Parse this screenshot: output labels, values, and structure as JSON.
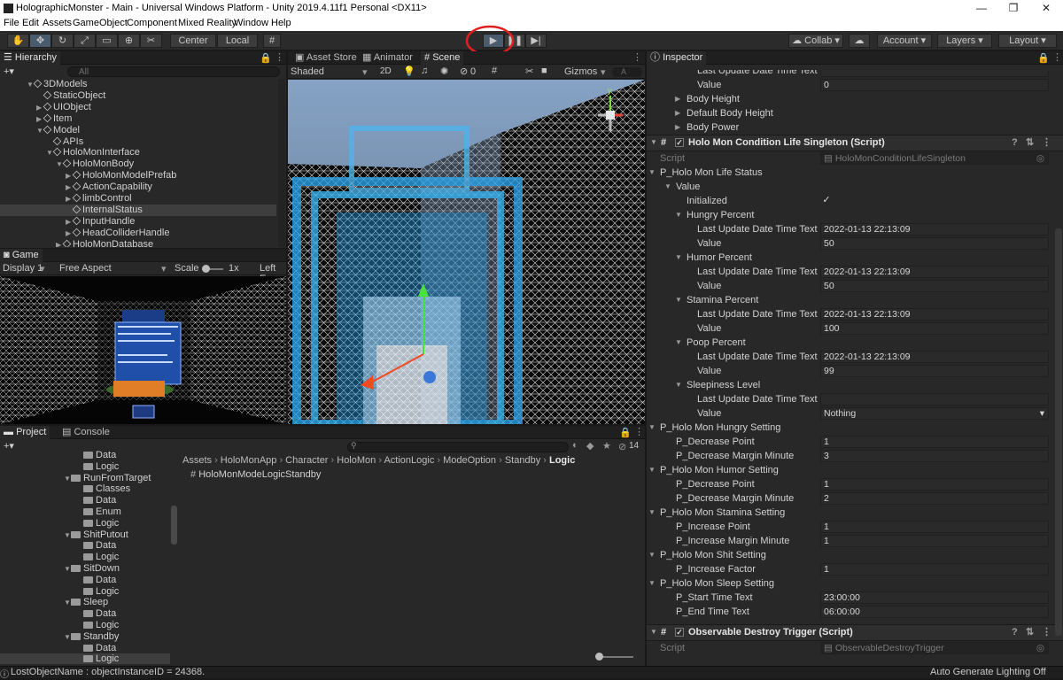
{
  "window": {
    "title": "HolographicMonster - Main - Universal Windows Platform - Unity 2019.4.11f1 Personal <DX11>",
    "minimize": "—",
    "maximize": "❐",
    "close": "✕"
  },
  "menubar": [
    "File",
    "Edit",
    "Assets",
    "GameObject",
    "Component",
    "Mixed Reality",
    "Window",
    "Help"
  ],
  "toolbar": {
    "center_label": "Center",
    "local_label": "Local",
    "collab_label": "Collab",
    "account_label": "Account",
    "layers_label": "Layers",
    "layout_label": "Layout",
    "play_highlight_color": "#e02020"
  },
  "hierarchy": {
    "tab_label": "Hierarchy",
    "search_placeholder": "All",
    "items": [
      {
        "label": "3DModels",
        "depth": 3,
        "arrow": "▼"
      },
      {
        "label": "StaticObject",
        "depth": 4,
        "arrow": ""
      },
      {
        "label": "UIObject",
        "depth": 4,
        "arrow": "▶"
      },
      {
        "label": "Item",
        "depth": 4,
        "arrow": "▶"
      },
      {
        "label": "Model",
        "depth": 4,
        "arrow": "▼"
      },
      {
        "label": "APIs",
        "depth": 5,
        "arrow": ""
      },
      {
        "label": "HoloMonInterface",
        "depth": 5,
        "arrow": "▼"
      },
      {
        "label": "HoloMonBody",
        "depth": 6,
        "arrow": "▼"
      },
      {
        "label": "HoloMonModelPrefab",
        "depth": 7,
        "arrow": "▶"
      },
      {
        "label": "ActionCapability",
        "depth": 7,
        "arrow": "▶"
      },
      {
        "label": "limbControl",
        "depth": 7,
        "arrow": "▶"
      },
      {
        "label": "InternalStatus",
        "depth": 7,
        "arrow": "",
        "selected": true
      },
      {
        "label": "InputHandle",
        "depth": 7,
        "arrow": "▶"
      },
      {
        "label": "HeadColliderHandle",
        "depth": 7,
        "arrow": "▶"
      },
      {
        "label": "HoloMonDatabase",
        "depth": 6,
        "arrow": "▶"
      }
    ]
  },
  "game": {
    "tab_label": "Game",
    "display_label": "Display 1",
    "aspect_label": "Free Aspect",
    "scale_label": "Scale",
    "scale_value": "1x",
    "left_eye_label": "Left Ey"
  },
  "scene": {
    "tabs": [
      "Asset Store",
      "Animator",
      "Scene"
    ],
    "shading_label": "Shaded",
    "mode_2d": "2D",
    "hidden_count": "0",
    "gizmos_label": "Gizmos",
    "search_placeholder": "A"
  },
  "project": {
    "tabs": [
      "Project",
      "Console"
    ],
    "tree": [
      {
        "label": "Data",
        "depth": 2,
        "arrow": ""
      },
      {
        "label": "Logic",
        "depth": 2,
        "arrow": ""
      },
      {
        "label": "RunFromTarget",
        "depth": 1,
        "arrow": "▼"
      },
      {
        "label": "Classes",
        "depth": 2,
        "arrow": ""
      },
      {
        "label": "Data",
        "depth": 2,
        "arrow": ""
      },
      {
        "label": "Enum",
        "depth": 2,
        "arrow": ""
      },
      {
        "label": "Logic",
        "depth": 2,
        "arrow": ""
      },
      {
        "label": "ShitPutout",
        "depth": 1,
        "arrow": "▼"
      },
      {
        "label": "Data",
        "depth": 2,
        "arrow": ""
      },
      {
        "label": "Logic",
        "depth": 2,
        "arrow": ""
      },
      {
        "label": "SitDown",
        "depth": 1,
        "arrow": "▼"
      },
      {
        "label": "Data",
        "depth": 2,
        "arrow": ""
      },
      {
        "label": "Logic",
        "depth": 2,
        "arrow": ""
      },
      {
        "label": "Sleep",
        "depth": 1,
        "arrow": "▼"
      },
      {
        "label": "Data",
        "depth": 2,
        "arrow": ""
      },
      {
        "label": "Logic",
        "depth": 2,
        "arrow": ""
      },
      {
        "label": "Standby",
        "depth": 1,
        "arrow": "▼"
      },
      {
        "label": "Data",
        "depth": 2,
        "arrow": ""
      },
      {
        "label": "Logic",
        "depth": 2,
        "arrow": "",
        "selected": true
      }
    ],
    "breadcrumb": [
      "Assets",
      "HoloMonApp",
      "Character",
      "HoloMon",
      "ActionLogic",
      "ModeOption",
      "Standby",
      "Logic"
    ],
    "files": [
      "HoloMonModeLogicStandby"
    ],
    "badge_count": "14"
  },
  "inspector": {
    "tab_label": "Inspector",
    "rows": [
      {
        "kind": "prop",
        "label": "Last Update Date Time Text",
        "indent": 3,
        "value": ""
      },
      {
        "kind": "prop",
        "label": "Value",
        "indent": 3,
        "value": "0"
      },
      {
        "kind": "fold",
        "label": "Body Height",
        "indent": 2
      },
      {
        "kind": "fold",
        "label": "Default Body Height",
        "indent": 2
      },
      {
        "kind": "fold",
        "label": "Body Power",
        "indent": 2
      },
      {
        "kind": "component",
        "label": "Holo Mon Condition Life Singleton (Script)"
      },
      {
        "kind": "script",
        "label": "Script",
        "value": "HoloMonConditionLifeSingleton"
      },
      {
        "kind": "fold-open",
        "label": "P_Holo Mon Life Status",
        "indent": 0
      },
      {
        "kind": "fold-open",
        "label": "Value",
        "indent": 1
      },
      {
        "kind": "check",
        "label": "Initialized",
        "indent": 2,
        "value": "✓"
      },
      {
        "kind": "fold-open",
        "label": "Hungry Percent",
        "indent": 2
      },
      {
        "kind": "prop",
        "label": "Last Update Date Time Text",
        "indent": 3,
        "value": "2022-01-13 22:13:09"
      },
      {
        "kind": "prop",
        "label": "Value",
        "indent": 3,
        "value": "50"
      },
      {
        "kind": "fold-open",
        "label": "Humor Percent",
        "indent": 2
      },
      {
        "kind": "prop",
        "label": "Last Update Date Time Text",
        "indent": 3,
        "value": "2022-01-13 22:13:09"
      },
      {
        "kind": "prop",
        "label": "Value",
        "indent": 3,
        "value": "50"
      },
      {
        "kind": "fold-open",
        "label": "Stamina Percent",
        "indent": 2
      },
      {
        "kind": "prop",
        "label": "Last Update Date Time Text",
        "indent": 3,
        "value": "2022-01-13 22:13:09"
      },
      {
        "kind": "prop",
        "label": "Value",
        "indent": 3,
        "value": "100"
      },
      {
        "kind": "fold-open",
        "label": "Poop Percent",
        "indent": 2
      },
      {
        "kind": "prop",
        "label": "Last Update Date Time Text",
        "indent": 3,
        "value": "2022-01-13 22:13:09"
      },
      {
        "kind": "prop",
        "label": "Value",
        "indent": 3,
        "value": "99"
      },
      {
        "kind": "fold-open",
        "label": "Sleepiness Level",
        "indent": 2
      },
      {
        "kind": "prop",
        "label": "Last Update Date Time Text",
        "indent": 3,
        "value": ""
      },
      {
        "kind": "dropdown",
        "label": "Value",
        "indent": 3,
        "value": "Nothing"
      },
      {
        "kind": "fold-open",
        "label": "P_Holo Mon Hungry Setting",
        "indent": 0
      },
      {
        "kind": "prop",
        "label": "P_Decrease Point",
        "indent": 1,
        "value": "1"
      },
      {
        "kind": "prop",
        "label": "P_Decrease Margin Minute",
        "indent": 1,
        "value": "3"
      },
      {
        "kind": "fold-open",
        "label": "P_Holo Mon Humor Setting",
        "indent": 0
      },
      {
        "kind": "prop",
        "label": "P_Decrease Point",
        "indent": 1,
        "value": "1"
      },
      {
        "kind": "prop",
        "label": "P_Decrease Margin Minute",
        "indent": 1,
        "value": "2"
      },
      {
        "kind": "fold-open",
        "label": "P_Holo Mon Stamina Setting",
        "indent": 0
      },
      {
        "kind": "prop",
        "label": "P_Increase Point",
        "indent": 1,
        "value": "1"
      },
      {
        "kind": "prop",
        "label": "P_Increase Margin Minute",
        "indent": 1,
        "value": "1"
      },
      {
        "kind": "fold-open",
        "label": "P_Holo Mon Shit Setting",
        "indent": 0
      },
      {
        "kind": "prop",
        "label": "P_Increase Factor",
        "indent": 1,
        "value": "1"
      },
      {
        "kind": "fold-open",
        "label": "P_Holo Mon Sleep Setting",
        "indent": 0
      },
      {
        "kind": "prop",
        "label": "P_Start Time Text",
        "indent": 1,
        "value": "23:00:00"
      },
      {
        "kind": "prop",
        "label": "P_End Time Text",
        "indent": 1,
        "value": "06:00:00"
      },
      {
        "kind": "spacer"
      },
      {
        "kind": "component",
        "label": "Observable Destroy Trigger (Script)"
      },
      {
        "kind": "script",
        "label": "Script",
        "value": "ObservableDestroyTrigger"
      }
    ]
  },
  "statusbar": {
    "message": "LostObjectName : objectInstanceID = 24368.",
    "right": "Auto Generate Lighting Off"
  }
}
